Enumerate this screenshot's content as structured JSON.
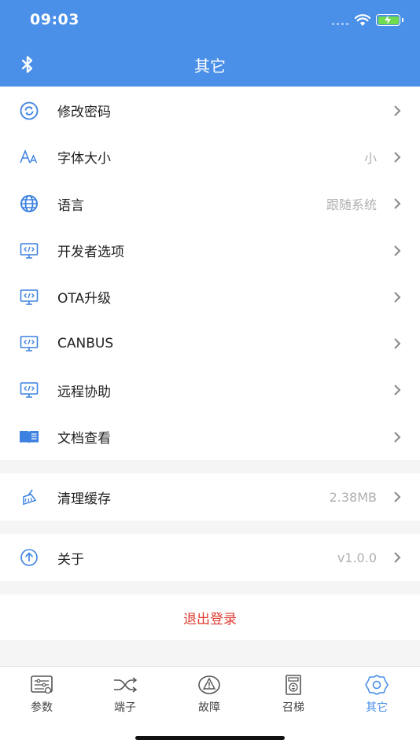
{
  "status": {
    "time": "09:03"
  },
  "nav": {
    "title": "其它"
  },
  "menu": {
    "items": [
      {
        "label": "修改密码",
        "value": "",
        "icon": "sync-lock-icon"
      },
      {
        "label": "字体大小",
        "value": "小",
        "icon": "font-size-icon"
      },
      {
        "label": "语言",
        "value": "跟随系统",
        "icon": "globe-icon"
      },
      {
        "label": "开发者选项",
        "value": "",
        "icon": "code-monitor-icon"
      },
      {
        "label": "OTA升级",
        "value": "",
        "icon": "code-monitor-icon"
      },
      {
        "label": "CANBUS",
        "value": "",
        "icon": "code-monitor-icon"
      },
      {
        "label": "远程协助",
        "value": "",
        "icon": "code-monitor-icon"
      },
      {
        "label": "文档查看",
        "value": "",
        "icon": "book-icon"
      }
    ],
    "cache": {
      "label": "清理缓存",
      "value": "2.38MB",
      "icon": "broom-icon"
    },
    "about": {
      "label": "关于",
      "value": "v1.0.0",
      "icon": "upload-circle-icon"
    }
  },
  "logout": {
    "label": "退出登录"
  },
  "tabs": [
    {
      "label": "参数",
      "icon": "params-icon",
      "active": false
    },
    {
      "label": "端子",
      "icon": "terminal-icon",
      "active": false
    },
    {
      "label": "故障",
      "icon": "fault-icon",
      "active": false
    },
    {
      "label": "召梯",
      "icon": "elevator-call-icon",
      "active": false
    },
    {
      "label": "其它",
      "icon": "settings-icon",
      "active": true
    }
  ],
  "colors": {
    "primary": "#4a8fe8",
    "danger": "#e03a2f",
    "battery": "#6fdc4f"
  }
}
